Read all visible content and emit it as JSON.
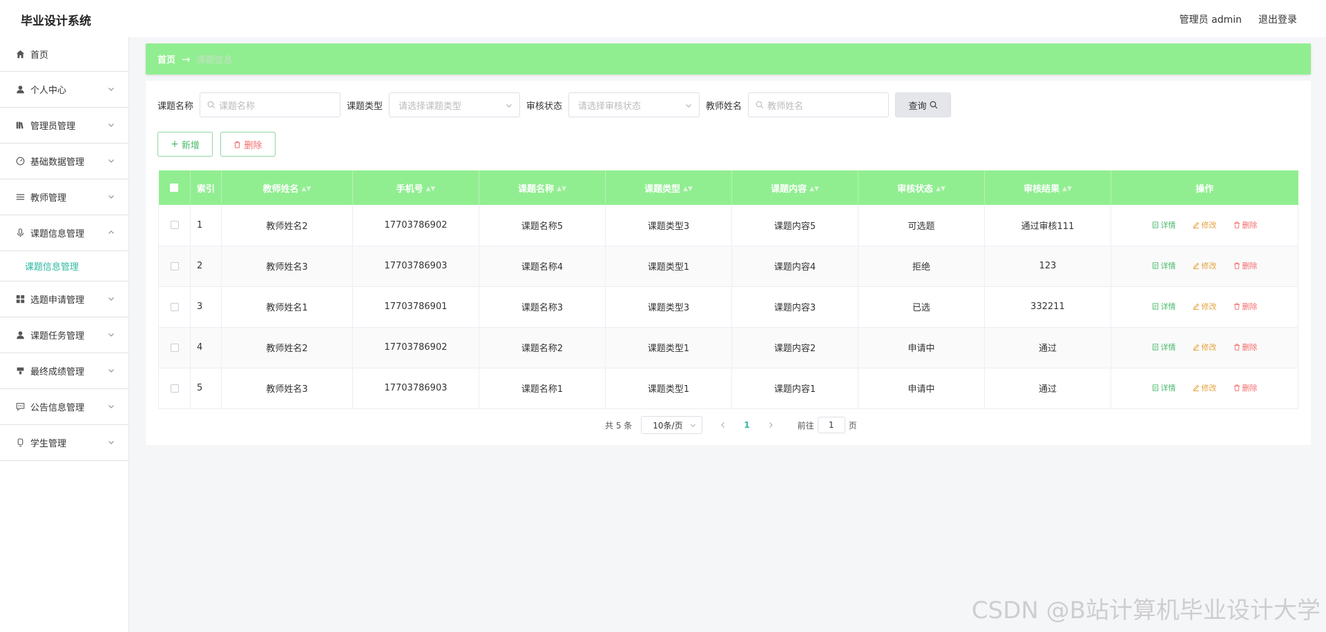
{
  "app": {
    "title": "毕业设计系统",
    "user_label": "管理员 admin",
    "logout_label": "退出登录"
  },
  "sidebar": {
    "items": [
      {
        "label": "首页",
        "icon": "home-icon",
        "expandable": false,
        "expanded": false
      },
      {
        "label": "个人中心",
        "icon": "user-icon",
        "expandable": true,
        "expanded": false
      },
      {
        "label": "管理员管理",
        "icon": "books-icon",
        "expandable": true,
        "expanded": false
      },
      {
        "label": "基础数据管理",
        "icon": "gauge-icon",
        "expandable": true,
        "expanded": false
      },
      {
        "label": "教师管理",
        "icon": "list-icon",
        "expandable": true,
        "expanded": false
      },
      {
        "label": "课题信息管理",
        "icon": "microphone-icon",
        "expandable": true,
        "expanded": true
      },
      {
        "label": "选题申请管理",
        "icon": "grid-icon",
        "expandable": true,
        "expanded": false
      },
      {
        "label": "课题任务管理",
        "icon": "user-icon",
        "expandable": true,
        "expanded": false
      },
      {
        "label": "最终成绩管理",
        "icon": "award-icon",
        "expandable": true,
        "expanded": false
      },
      {
        "label": "公告信息管理",
        "icon": "message-icon",
        "expandable": true,
        "expanded": false
      },
      {
        "label": "学生管理",
        "icon": "student-icon",
        "expandable": true,
        "expanded": false
      }
    ],
    "submenu": {
      "label": "课题信息管理"
    }
  },
  "breadcrumb": {
    "home": "首页",
    "separator": "→",
    "current": "课题信息"
  },
  "search": {
    "topic_name_label": "课题名称",
    "topic_name_placeholder": "课题名称",
    "topic_type_label": "课题类型",
    "topic_type_placeholder": "请选择课题类型",
    "review_status_label": "审核状态",
    "review_status_placeholder": "请选择审核状态",
    "teacher_name_label": "教师姓名",
    "teacher_name_placeholder": "教师姓名",
    "query_label": "查询"
  },
  "actions": {
    "add_label": "新增",
    "delete_label": "删除"
  },
  "table": {
    "columns": [
      "索引",
      "教师姓名",
      "手机号",
      "课题名称",
      "课题类型",
      "课题内容",
      "审核状态",
      "审核结果",
      "操作"
    ],
    "rows": [
      {
        "index": "1",
        "teacher": "教师姓名2",
        "phone": "17703786902",
        "topic": "课题名称5",
        "type": "课题类型3",
        "content": "课题内容5",
        "status": "可选题",
        "result": "通过审核111"
      },
      {
        "index": "2",
        "teacher": "教师姓名3",
        "phone": "17703786903",
        "topic": "课题名称4",
        "type": "课题类型1",
        "content": "课题内容4",
        "status": "拒绝",
        "result": "123"
      },
      {
        "index": "3",
        "teacher": "教师姓名1",
        "phone": "17703786901",
        "topic": "课题名称3",
        "type": "课题类型3",
        "content": "课题内容3",
        "status": "已选",
        "result": "332211"
      },
      {
        "index": "4",
        "teacher": "教师姓名2",
        "phone": "17703786902",
        "topic": "课题名称2",
        "type": "课题类型1",
        "content": "课题内容2",
        "status": "申请中",
        "result": "通过"
      },
      {
        "index": "5",
        "teacher": "教师姓名3",
        "phone": "17703786903",
        "topic": "课题名称1",
        "type": "课题类型1",
        "content": "课题内容1",
        "status": "申请中",
        "result": "通过"
      }
    ],
    "op_detail": "详情",
    "op_edit": "修改",
    "op_delete": "删除"
  },
  "pagination": {
    "total_text": "共 5 条",
    "page_size": "10条/页",
    "current_page": "1",
    "goto_prefix": "前往",
    "goto_value": "1",
    "goto_suffix": "页"
  },
  "watermark": "CSDN @B站计算机毕业设计大学",
  "colors": {
    "accent_green": "#90ee90",
    "teal": "#2eb8a0",
    "detail": "#49b96a",
    "edit": "#e6a23c",
    "delete": "#f56c6c"
  }
}
